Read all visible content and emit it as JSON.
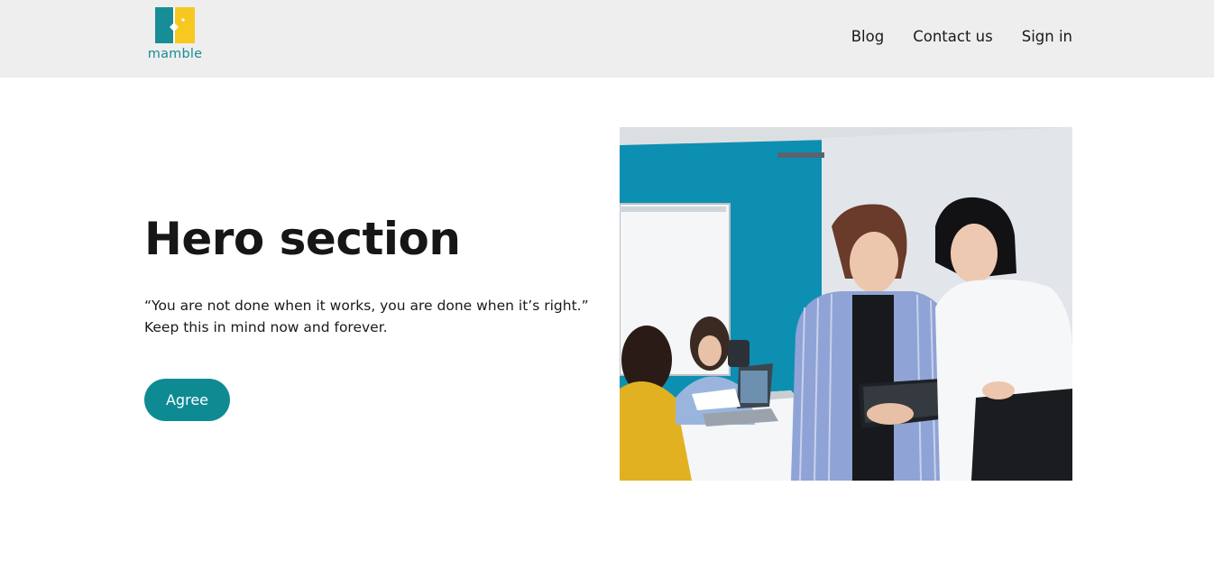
{
  "brand": {
    "name": "mamble",
    "colors": {
      "teal": "#0e8a93",
      "yellow": "#f6c820",
      "header_bg": "#eeeeee"
    }
  },
  "nav": {
    "items": [
      {
        "label": "Blog"
      },
      {
        "label": "Contact us"
      },
      {
        "label": "Sign in"
      }
    ]
  },
  "hero": {
    "title": "Hero section",
    "quote": "“You are not done when it works, you are done when it’s right.”",
    "subtext": "Keep this in mind now and forever.",
    "cta_label": "Agree",
    "image": {
      "subject": "two women looking at a tablet in an office with colleagues at a table behind them"
    }
  }
}
